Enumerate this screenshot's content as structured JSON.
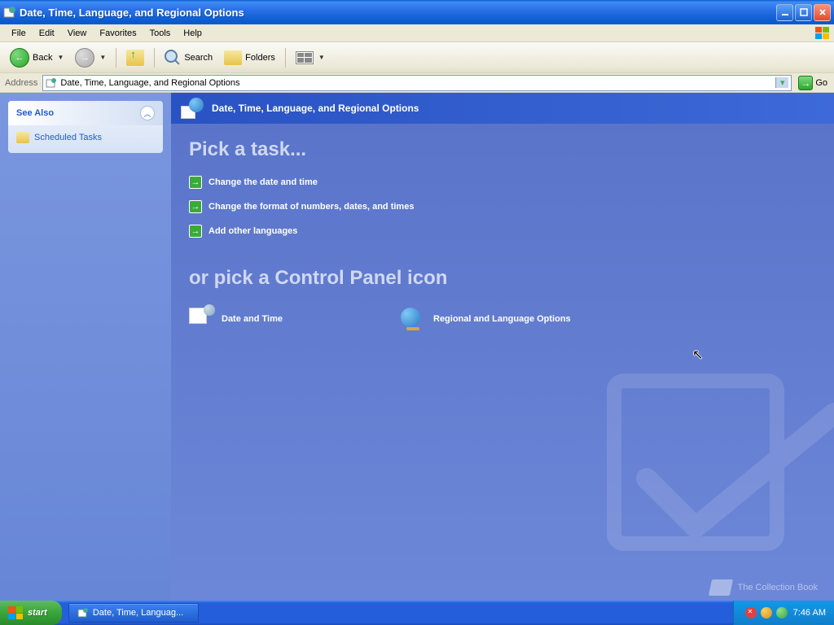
{
  "window": {
    "title": "Date, Time, Language, and Regional Options"
  },
  "menu": {
    "file": "File",
    "edit": "Edit",
    "view": "View",
    "favorites": "Favorites",
    "tools": "Tools",
    "help": "Help"
  },
  "toolbar": {
    "back": "Back",
    "search": "Search",
    "folders": "Folders"
  },
  "address": {
    "label": "Address",
    "value": "Date, Time, Language, and Regional Options",
    "go": "Go"
  },
  "sidebar": {
    "see_also_title": "See Also",
    "scheduled_tasks": "Scheduled Tasks"
  },
  "main": {
    "header_title": "Date, Time, Language, and Regional Options",
    "pick_task": "Pick a task...",
    "tasks": {
      "t1": "Change the date and time",
      "t2": "Change the format of numbers, dates, and times",
      "t3": "Add other languages"
    },
    "or_pick": "or pick a Control Panel icon",
    "icons": {
      "date_time": "Date and Time",
      "regional": "Regional and Language Options"
    }
  },
  "watermark": "The Collection Book",
  "taskbar": {
    "start": "start",
    "task_button": "Date, Time, Languag...",
    "clock": "7:46 AM"
  }
}
